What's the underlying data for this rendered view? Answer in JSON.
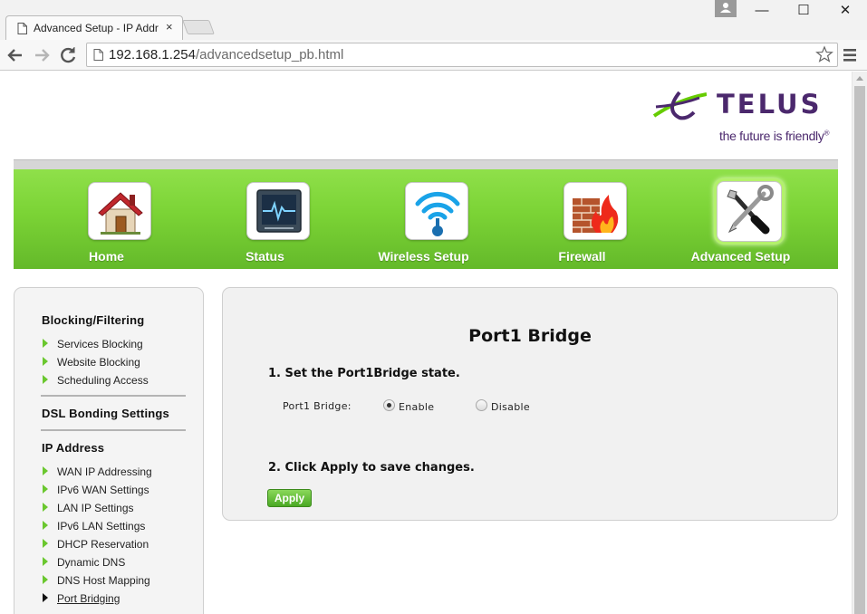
{
  "browser": {
    "tab_title": "Advanced Setup - IP Addr",
    "tab_close": "×",
    "url_host": "192.168.1.254",
    "url_path": "/advancedsetup_pb.html",
    "window_controls": {
      "minimize": "—",
      "maximize": "☐",
      "close": "✕"
    }
  },
  "brand": {
    "name": "TELUS",
    "tagline": "the future is friendly",
    "tagline_mark": "®",
    "color": "#4b286d",
    "accent": "#66cc00"
  },
  "main_nav": [
    {
      "label": "Home",
      "icon": "house-icon"
    },
    {
      "label": "Status",
      "icon": "monitor-icon"
    },
    {
      "label": "Wireless Setup",
      "icon": "wifi-icon"
    },
    {
      "label": "Firewall",
      "icon": "firewall-icon"
    },
    {
      "label": "Advanced Setup",
      "icon": "tools-icon",
      "active": true
    }
  ],
  "sidebar": {
    "sections": [
      {
        "heading": "Blocking/Filtering",
        "links": [
          "Services Blocking",
          "Website Blocking",
          "Scheduling Access"
        ]
      },
      {
        "heading": "DSL Bonding Settings",
        "links": []
      },
      {
        "heading": "IP Address",
        "links": [
          "WAN IP Addressing",
          "IPv6 WAN Settings",
          "LAN IP Settings",
          "IPv6 LAN Settings",
          "DHCP Reservation",
          "Dynamic DNS",
          "DNS Host Mapping",
          "Port Bridging"
        ]
      }
    ],
    "current": "Port Bridging"
  },
  "panel": {
    "title": "Port1 Bridge",
    "step1": "1. Set the Port1Bridge state.",
    "field_label": "Port1 Bridge:",
    "options": [
      {
        "label": "Enable",
        "checked": true
      },
      {
        "label": "Disable",
        "checked": false
      }
    ],
    "step2": "2. Click Apply to save changes.",
    "apply_label": "Apply"
  }
}
